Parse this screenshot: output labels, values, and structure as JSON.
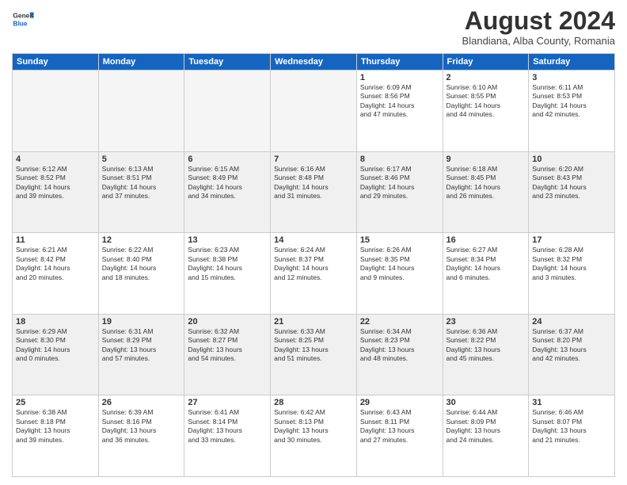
{
  "header": {
    "logo_general": "General",
    "logo_blue": "Blue",
    "month_title": "August 2024",
    "location": "Blandiana, Alba County, Romania"
  },
  "days_of_week": [
    "Sunday",
    "Monday",
    "Tuesday",
    "Wednesday",
    "Thursday",
    "Friday",
    "Saturday"
  ],
  "weeks": [
    [
      {
        "day": "",
        "info": "",
        "empty": true
      },
      {
        "day": "",
        "info": "",
        "empty": true
      },
      {
        "day": "",
        "info": "",
        "empty": true
      },
      {
        "day": "",
        "info": "",
        "empty": true
      },
      {
        "day": "1",
        "info": "Sunrise: 6:09 AM\nSunset: 8:56 PM\nDaylight: 14 hours\nand 47 minutes."
      },
      {
        "day": "2",
        "info": "Sunrise: 6:10 AM\nSunset: 8:55 PM\nDaylight: 14 hours\nand 44 minutes."
      },
      {
        "day": "3",
        "info": "Sunrise: 6:11 AM\nSunset: 8:53 PM\nDaylight: 14 hours\nand 42 minutes."
      }
    ],
    [
      {
        "day": "4",
        "info": "Sunrise: 6:12 AM\nSunset: 8:52 PM\nDaylight: 14 hours\nand 39 minutes.",
        "shaded": true
      },
      {
        "day": "5",
        "info": "Sunrise: 6:13 AM\nSunset: 8:51 PM\nDaylight: 14 hours\nand 37 minutes.",
        "shaded": true
      },
      {
        "day": "6",
        "info": "Sunrise: 6:15 AM\nSunset: 8:49 PM\nDaylight: 14 hours\nand 34 minutes.",
        "shaded": true
      },
      {
        "day": "7",
        "info": "Sunrise: 6:16 AM\nSunset: 8:48 PM\nDaylight: 14 hours\nand 31 minutes.",
        "shaded": true
      },
      {
        "day": "8",
        "info": "Sunrise: 6:17 AM\nSunset: 8:46 PM\nDaylight: 14 hours\nand 29 minutes.",
        "shaded": true
      },
      {
        "day": "9",
        "info": "Sunrise: 6:18 AM\nSunset: 8:45 PM\nDaylight: 14 hours\nand 26 minutes.",
        "shaded": true
      },
      {
        "day": "10",
        "info": "Sunrise: 6:20 AM\nSunset: 8:43 PM\nDaylight: 14 hours\nand 23 minutes.",
        "shaded": true
      }
    ],
    [
      {
        "day": "11",
        "info": "Sunrise: 6:21 AM\nSunset: 8:42 PM\nDaylight: 14 hours\nand 20 minutes."
      },
      {
        "day": "12",
        "info": "Sunrise: 6:22 AM\nSunset: 8:40 PM\nDaylight: 14 hours\nand 18 minutes."
      },
      {
        "day": "13",
        "info": "Sunrise: 6:23 AM\nSunset: 8:38 PM\nDaylight: 14 hours\nand 15 minutes."
      },
      {
        "day": "14",
        "info": "Sunrise: 6:24 AM\nSunset: 8:37 PM\nDaylight: 14 hours\nand 12 minutes."
      },
      {
        "day": "15",
        "info": "Sunrise: 6:26 AM\nSunset: 8:35 PM\nDaylight: 14 hours\nand 9 minutes."
      },
      {
        "day": "16",
        "info": "Sunrise: 6:27 AM\nSunset: 8:34 PM\nDaylight: 14 hours\nand 6 minutes."
      },
      {
        "day": "17",
        "info": "Sunrise: 6:28 AM\nSunset: 8:32 PM\nDaylight: 14 hours\nand 3 minutes."
      }
    ],
    [
      {
        "day": "18",
        "info": "Sunrise: 6:29 AM\nSunset: 8:30 PM\nDaylight: 14 hours\nand 0 minutes.",
        "shaded": true
      },
      {
        "day": "19",
        "info": "Sunrise: 6:31 AM\nSunset: 8:29 PM\nDaylight: 13 hours\nand 57 minutes.",
        "shaded": true
      },
      {
        "day": "20",
        "info": "Sunrise: 6:32 AM\nSunset: 8:27 PM\nDaylight: 13 hours\nand 54 minutes.",
        "shaded": true
      },
      {
        "day": "21",
        "info": "Sunrise: 6:33 AM\nSunset: 8:25 PM\nDaylight: 13 hours\nand 51 minutes.",
        "shaded": true
      },
      {
        "day": "22",
        "info": "Sunrise: 6:34 AM\nSunset: 8:23 PM\nDaylight: 13 hours\nand 48 minutes.",
        "shaded": true
      },
      {
        "day": "23",
        "info": "Sunrise: 6:36 AM\nSunset: 8:22 PM\nDaylight: 13 hours\nand 45 minutes.",
        "shaded": true
      },
      {
        "day": "24",
        "info": "Sunrise: 6:37 AM\nSunset: 8:20 PM\nDaylight: 13 hours\nand 42 minutes.",
        "shaded": true
      }
    ],
    [
      {
        "day": "25",
        "info": "Sunrise: 6:38 AM\nSunset: 8:18 PM\nDaylight: 13 hours\nand 39 minutes."
      },
      {
        "day": "26",
        "info": "Sunrise: 6:39 AM\nSunset: 8:16 PM\nDaylight: 13 hours\nand 36 minutes."
      },
      {
        "day": "27",
        "info": "Sunrise: 6:41 AM\nSunset: 8:14 PM\nDaylight: 13 hours\nand 33 minutes."
      },
      {
        "day": "28",
        "info": "Sunrise: 6:42 AM\nSunset: 8:13 PM\nDaylight: 13 hours\nand 30 minutes."
      },
      {
        "day": "29",
        "info": "Sunrise: 6:43 AM\nSunset: 8:11 PM\nDaylight: 13 hours\nand 27 minutes."
      },
      {
        "day": "30",
        "info": "Sunrise: 6:44 AM\nSunset: 8:09 PM\nDaylight: 13 hours\nand 24 minutes."
      },
      {
        "day": "31",
        "info": "Sunrise: 6:46 AM\nSunset: 8:07 PM\nDaylight: 13 hours\nand 21 minutes."
      }
    ]
  ]
}
